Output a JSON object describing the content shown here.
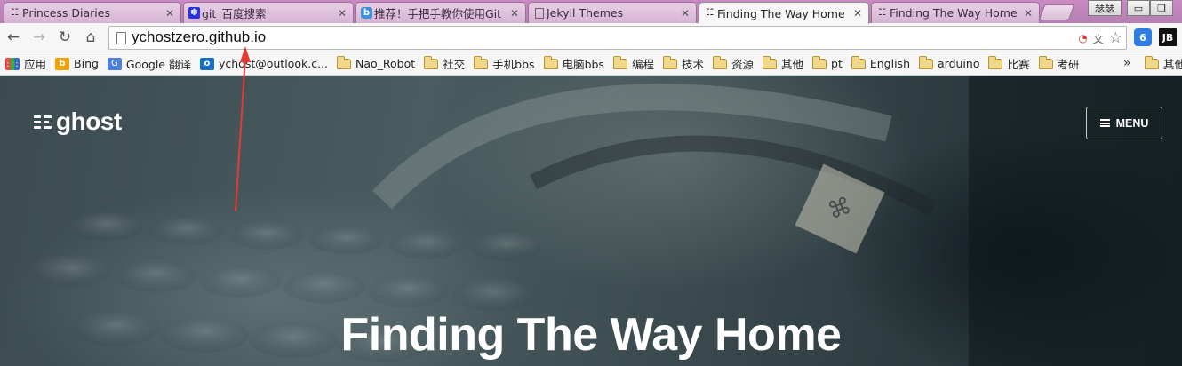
{
  "browser": {
    "tabs": [
      {
        "title": "Princess Diaries",
        "icon": "ghost-favicon-icon"
      },
      {
        "title": "git_百度搜索",
        "icon": "baidu-paw-icon"
      },
      {
        "title": "推荐！手把手教你使用Git",
        "icon": "blog-b-icon"
      },
      {
        "title": "Jekyll Themes",
        "icon": "page-icon"
      },
      {
        "title": "Finding The Way Home",
        "icon": "ghost-favicon-icon",
        "active": true
      },
      {
        "title": "Finding The Way Home",
        "icon": "ghost-favicon-icon"
      }
    ],
    "window_label": "瑟瑟",
    "url": "ychostzero.github.io",
    "ext_jb_label": "JB"
  },
  "bookmarks": {
    "items": [
      {
        "label": "应用",
        "type": "apps"
      },
      {
        "label": "Bing",
        "type": "bing"
      },
      {
        "label": "Google 翻译",
        "type": "translate"
      },
      {
        "label": "ychost@outlook.c...",
        "type": "outlook"
      },
      {
        "label": "Nao_Robot",
        "type": "folder"
      },
      {
        "label": "社交",
        "type": "folder"
      },
      {
        "label": "手机bbs",
        "type": "folder"
      },
      {
        "label": "电脑bbs",
        "type": "folder"
      },
      {
        "label": "编程",
        "type": "folder"
      },
      {
        "label": "技术",
        "type": "folder"
      },
      {
        "label": "资源",
        "type": "folder"
      },
      {
        "label": "其他",
        "type": "folder"
      },
      {
        "label": "pt",
        "type": "folder"
      },
      {
        "label": "English",
        "type": "folder"
      },
      {
        "label": "arduino",
        "type": "folder"
      },
      {
        "label": "比赛",
        "type": "folder"
      },
      {
        "label": "考研",
        "type": "folder"
      }
    ],
    "more": "»",
    "other_label": "其他"
  },
  "page": {
    "logo_text": "ghost",
    "menu_label": "MENU",
    "hero_title": "Finding The Way Home"
  },
  "colors": {
    "annotation_arrow": "#e53935",
    "tab_strip": "#c98bc2"
  }
}
